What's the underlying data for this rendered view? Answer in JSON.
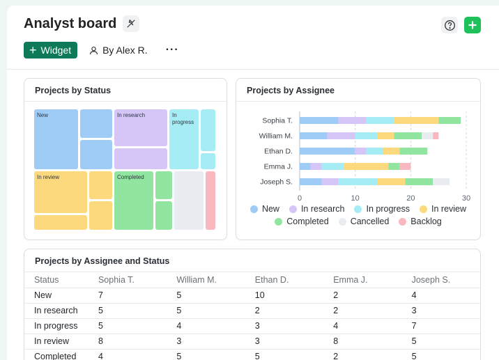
{
  "board": {
    "title": "Analyst board",
    "widget_label": "Widget",
    "owner_label": "By Alex R.",
    "more_label": "···"
  },
  "colors": {
    "new": "#9fcbf7",
    "in_research": "#d5c6f7",
    "in_progress": "#a6ecf5",
    "in_review": "#fcd97c",
    "completed": "#92e5a0",
    "cancelled": "#e9ecf1",
    "backlog": "#f9b7c0",
    "brand": "#0e7a5a",
    "add": "#1ec05a"
  },
  "treemap": {
    "title": "Projects by Status",
    "labels": {
      "new": "New",
      "in_research": "In research",
      "in_progress": "In progress",
      "in_review": "In review",
      "completed": "Completed"
    }
  },
  "assignee_chart": {
    "title": "Projects by Assignee",
    "legend": [
      "New",
      "In research",
      "In progress",
      "In review",
      "Completed",
      "Cancelled",
      "Backlog"
    ]
  },
  "chart_data": [
    {
      "type": "bar",
      "title": "Projects by Assignee",
      "orientation": "horizontal",
      "stacked": true,
      "categories": [
        "Sophia T.",
        "William M.",
        "Ethan D.",
        "Emma J.",
        "Joseph S."
      ],
      "xlim": [
        0,
        30
      ],
      "xticks": [
        0,
        10,
        20,
        30
      ],
      "grid": "vertical dashed",
      "legend_position": "bottom",
      "series": [
        {
          "name": "New",
          "values": [
            7,
            5,
            10,
            2,
            4
          ]
        },
        {
          "name": "In research",
          "values": [
            5,
            5,
            2,
            2,
            3
          ]
        },
        {
          "name": "In progress",
          "values": [
            5,
            4,
            3,
            4,
            7
          ]
        },
        {
          "name": "In review",
          "values": [
            8,
            3,
            3,
            8,
            5
          ]
        },
        {
          "name": "Completed",
          "values": [
            4,
            5,
            5,
            2,
            5
          ]
        },
        {
          "name": "Cancelled",
          "values": [
            0,
            2,
            0,
            0,
            3
          ]
        },
        {
          "name": "Backlog",
          "values": [
            0,
            1,
            0,
            2,
            0
          ]
        }
      ]
    }
  ],
  "table": {
    "title": "Projects by Assignee and Status",
    "headers": [
      "Status",
      "Sophia T.",
      "William M.",
      "Ethan D.",
      "Emma J.",
      "Joseph S."
    ],
    "rows": [
      [
        "New",
        "7",
        "5",
        "10",
        "2",
        "4"
      ],
      [
        "In research",
        "5",
        "5",
        "2",
        "2",
        "3"
      ],
      [
        "In progress",
        "5",
        "4",
        "3",
        "4",
        "7"
      ],
      [
        "In review",
        "8",
        "3",
        "3",
        "8",
        "5"
      ],
      [
        "Completed",
        "4",
        "5",
        "5",
        "2",
        "5"
      ]
    ]
  }
}
